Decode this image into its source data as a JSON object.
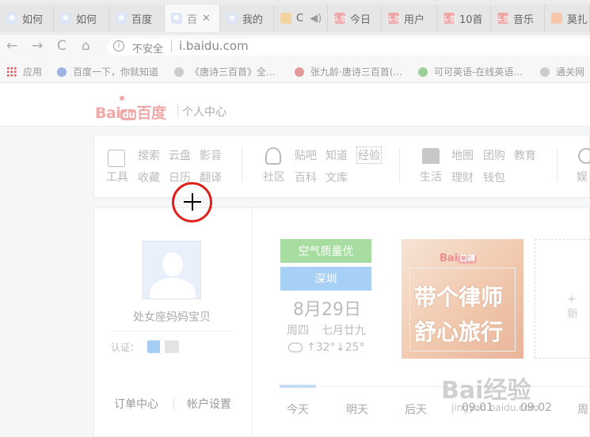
{
  "tabs": [
    {
      "label": "如何",
      "icon": "paw-icon"
    },
    {
      "label": "如何",
      "icon": "paw-icon"
    },
    {
      "label": "百度",
      "icon": "paw-icon"
    },
    {
      "label": "百",
      "icon": "paw-icon",
      "active": true
    },
    {
      "label": "我的",
      "icon": "paw-icon"
    },
    {
      "label": "C",
      "icon": "app-icon"
    },
    {
      "label": "今日",
      "icon": "toutiao-icon"
    },
    {
      "label": "用户",
      "icon": "toutiao-icon"
    },
    {
      "label": "10首",
      "icon": "toutiao-icon"
    },
    {
      "label": "音乐",
      "icon": "toutiao-icon"
    },
    {
      "label": "莫扎",
      "icon": "app-icon"
    }
  ],
  "toolbar": {
    "back": "←",
    "forward": "→",
    "reload": "C",
    "home": "⌂"
  },
  "address": {
    "security": "不安全",
    "url": "i.baidu.com"
  },
  "bookmarks": [
    {
      "label": "应用"
    },
    {
      "label": "百度一下，你就知道"
    },
    {
      "label": "《唐诗三百首》全..."
    },
    {
      "label": "张九龄·唐诗三百首(..."
    },
    {
      "label": "可可英语-在线英语..."
    },
    {
      "label": "通关网"
    }
  ],
  "header": {
    "logo_bai": "Bai",
    "logo_du": "du",
    "logo_cn": "百度",
    "title": "个人中心"
  },
  "services": {
    "tools": {
      "label": "工具",
      "items": [
        "搜索",
        "云盘",
        "影音",
        "收藏",
        "日历",
        "翻译"
      ]
    },
    "community": {
      "label": "社区",
      "items": [
        "贴吧",
        "知道",
        "经验",
        "百科",
        "文库"
      ]
    },
    "life": {
      "label": "生活",
      "items": [
        "地图",
        "团购",
        "教育",
        "理财",
        "钱包"
      ]
    },
    "fun": {
      "label": "娱"
    }
  },
  "profile": {
    "username": "处女座妈妈宝贝",
    "verify_label": "认证：",
    "order_center": "订单中心",
    "account_settings": "帐户设置"
  },
  "weather": {
    "air_quality": "空气质量优",
    "city": "深圳",
    "date": "8月29日",
    "weekday": "周四",
    "lunar": "七月廿九",
    "high": "↑32°",
    "low": "↓25°",
    "days": [
      "今天",
      "明天",
      "后天",
      "09.01",
      "09.02",
      "周"
    ]
  },
  "ad": {
    "brand_bai": "Bai",
    "brand_kb": "口碑",
    "line1": "带个律师",
    "line2": "舒心旅行"
  },
  "newcard": {
    "label": "+ 新"
  },
  "watermark": {
    "text": "Bai经验",
    "url": "jingyan.baidu.com"
  },
  "colors": {
    "air_good": "#a7dda0",
    "city": "#a6d0f5",
    "accent": "#c5ddf5"
  }
}
